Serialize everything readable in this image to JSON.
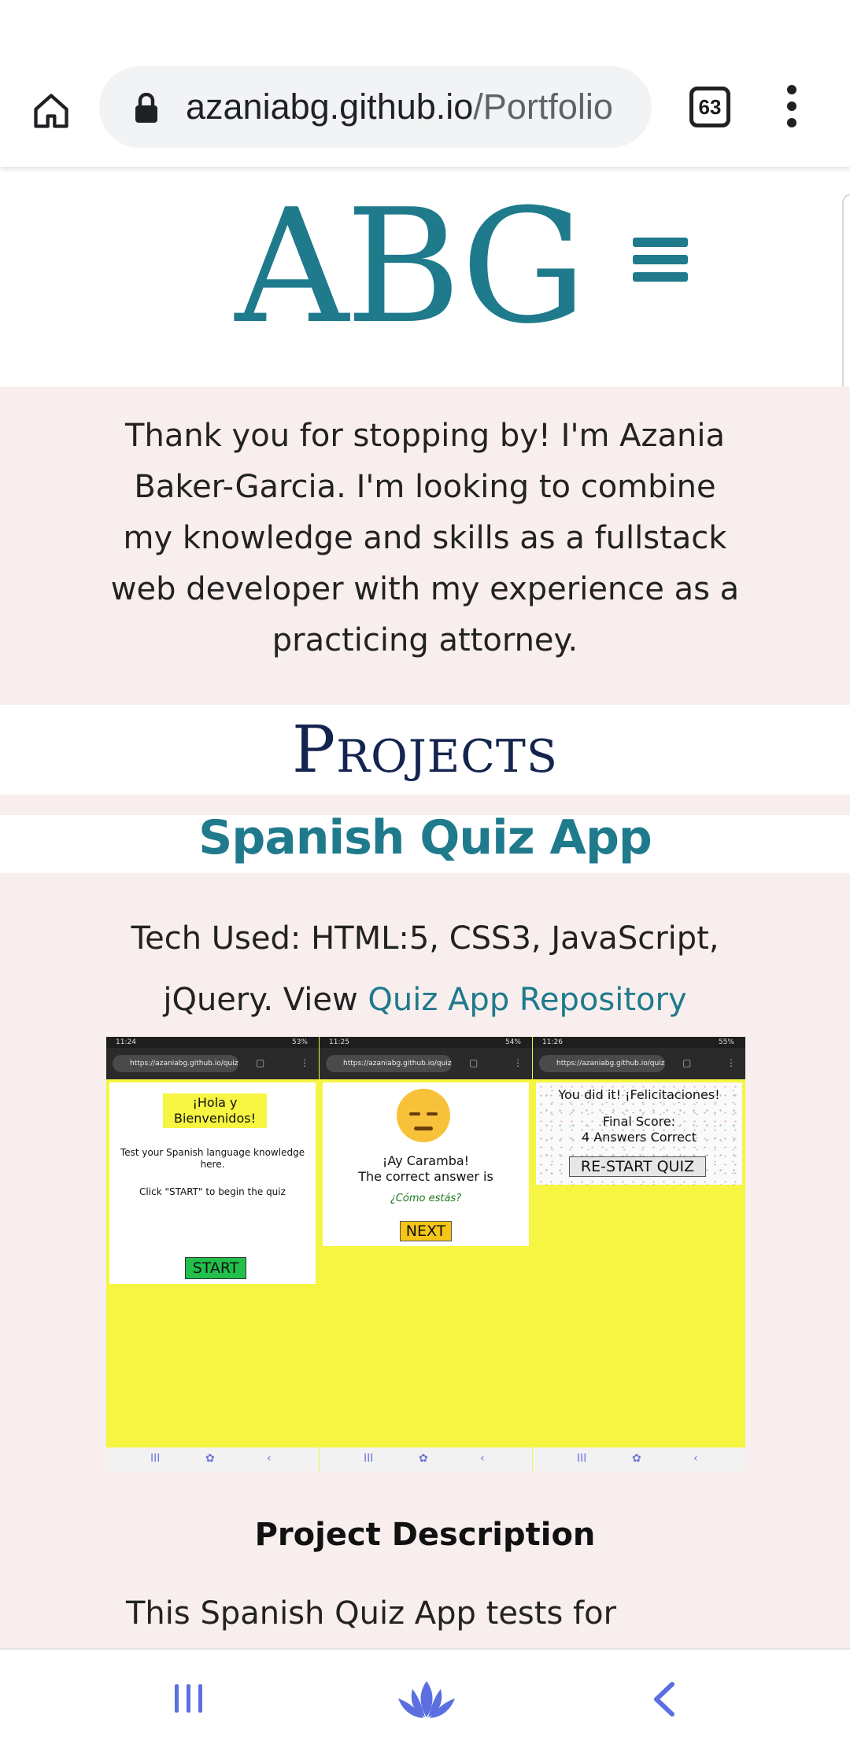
{
  "browser": {
    "url_host": "azaniabg.github.io",
    "url_path": "/Portfolio",
    "tab_count": "63"
  },
  "header": {
    "logo": "ABG"
  },
  "intro": {
    "text": "Thank you for stopping by! I'm Azania Baker-Garcia. I'm looking to combine my knowledge and skills as a fullstack web developer with my experience as a practicing attorney."
  },
  "projects": {
    "heading": "Projects",
    "project_title": "Spanish Quiz App",
    "tech_prefix": "Tech Used: HTML:5, CSS3, JavaScript, jQuery. View ",
    "tech_link": "Quiz App Repository",
    "screenshot": {
      "pane1": {
        "time": "11:24",
        "battery": "53%",
        "url": "https://azaniabg.github.io/quiz",
        "greeting": "¡Hola y Bienvenidos!",
        "line1": "Test your Spanish language knowledge here.",
        "line2": "Click \"START\" to begin the quiz",
        "button": "START"
      },
      "pane2": {
        "time": "11:25",
        "battery": "54%",
        "url": "https://azaniabg.github.io/quiz",
        "exclaim": "¡Ay Caramba!",
        "answer_label": "The correct answer is",
        "answer": "¿Cómo estás?",
        "button": "NEXT"
      },
      "pane3": {
        "time": "11:26",
        "battery": "55%",
        "url": "https://azaniabg.github.io/quiz",
        "congrats": "You did it! ¡Felicitaciones!",
        "score_label": "Final Score:",
        "score": "4 Answers Correct",
        "button": "RE-START QUIZ"
      }
    },
    "description_heading": "Project Description",
    "description_text": "This Spanish Quiz App tests for"
  },
  "icons": {
    "home": "home-icon",
    "lock": "lock-icon",
    "menu": "more-vert-icon",
    "hamburger": "hamburger-menu-icon",
    "recents": "recent-apps-icon",
    "home_lotus": "lotus-home-icon",
    "back": "back-icon"
  },
  "colors": {
    "accent": "#1f7a8c",
    "heading_navy": "#14244f",
    "band_pink": "#f8eeed",
    "quiz_yellow": "#f5f542",
    "nav_blue": "#5b6fe0"
  }
}
